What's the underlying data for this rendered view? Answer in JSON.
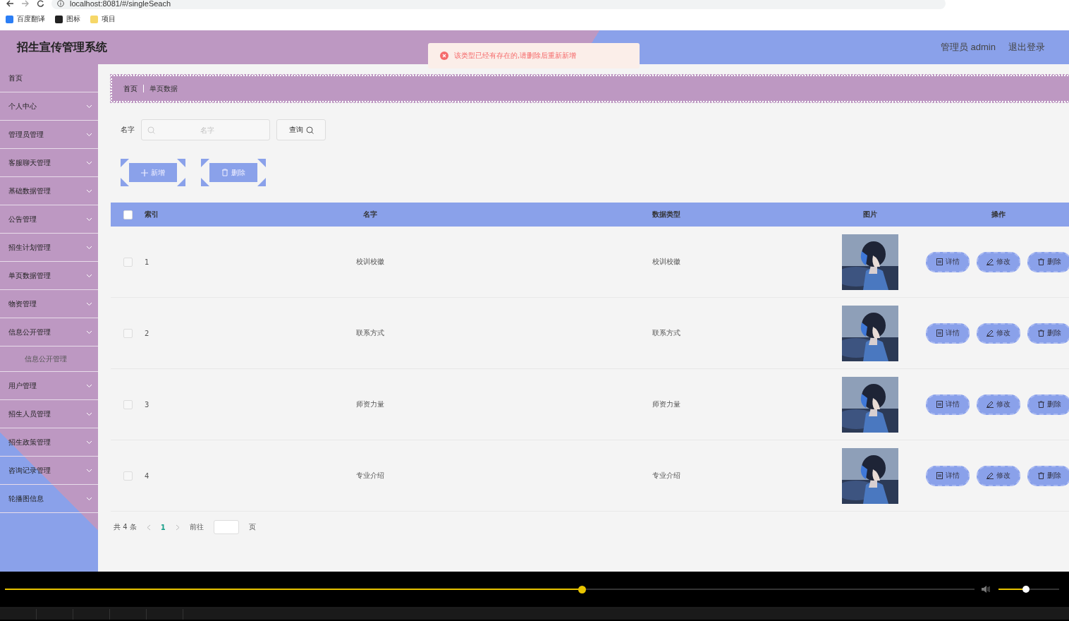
{
  "browser": {
    "url": "localhost:8081/#/singleSeach",
    "bookmarks": [
      {
        "label": "百度翻译",
        "kind": "translate"
      },
      {
        "label": "图标"
      },
      {
        "label": "项目",
        "kind": "folder"
      }
    ]
  },
  "header": {
    "title": "招生宣传管理系统",
    "user": "管理员 admin",
    "logout": "退出登录"
  },
  "toast": {
    "message": "该类型已经有存在的,请删除后重新新增"
  },
  "sidebar": {
    "items": [
      {
        "label": "首页",
        "kind": "link"
      },
      {
        "label": "个人中心",
        "kind": "menu"
      },
      {
        "label": "管理员管理",
        "kind": "menu"
      },
      {
        "label": "客服聊天管理",
        "kind": "menu"
      },
      {
        "label": "基础数据管理",
        "kind": "menu"
      },
      {
        "label": "公告管理",
        "kind": "menu"
      },
      {
        "label": "招生计划管理",
        "kind": "menu"
      },
      {
        "label": "单页数据管理",
        "kind": "menu"
      },
      {
        "label": "物资管理",
        "kind": "menu"
      },
      {
        "label": "信息公开管理",
        "kind": "menu",
        "children": [
          {
            "label": "信息公开管理"
          }
        ]
      },
      {
        "label": "用户管理",
        "kind": "menu"
      },
      {
        "label": "招生人员管理",
        "kind": "menu"
      },
      {
        "label": "招生政策管理",
        "kind": "menu"
      },
      {
        "label": "咨询记录管理",
        "kind": "menu"
      },
      {
        "label": "轮播图信息",
        "kind": "menu"
      }
    ]
  },
  "breadcrumb": [
    "首页",
    "单页数据"
  ],
  "search": {
    "label": "名字",
    "placeholder": "名字",
    "button": "查询"
  },
  "actions": [
    {
      "label": "新增",
      "kind": "add"
    },
    {
      "label": "删除",
      "kind": "delete"
    }
  ],
  "table": {
    "all_selected": false,
    "columns": [
      "索引",
      "名字",
      "数据类型",
      "图片",
      "操作"
    ],
    "rows": [
      {
        "index": "1",
        "name": "校训校徽",
        "type": "校训校徽",
        "selected": false,
        "actions": [
          {
            "label": "详情",
            "kind": "detail"
          },
          {
            "label": "修改",
            "kind": "edit"
          },
          {
            "label": "删除",
            "kind": "delete"
          }
        ]
      },
      {
        "index": "2",
        "name": "联系方式",
        "type": "联系方式",
        "selected": false,
        "actions": [
          {
            "label": "详情",
            "kind": "detail"
          },
          {
            "label": "修改",
            "kind": "edit"
          },
          {
            "label": "删除",
            "kind": "delete"
          }
        ]
      },
      {
        "index": "3",
        "name": "师资力量",
        "type": "师资力量",
        "selected": false,
        "actions": [
          {
            "label": "详情",
            "kind": "detail"
          },
          {
            "label": "修改",
            "kind": "edit"
          },
          {
            "label": "删除",
            "kind": "delete"
          }
        ]
      },
      {
        "index": "4",
        "name": "专业介绍",
        "type": "专业介绍",
        "selected": false,
        "actions": [
          {
            "label": "详情",
            "kind": "detail"
          },
          {
            "label": "修改",
            "kind": "edit"
          },
          {
            "label": "删除",
            "kind": "delete"
          }
        ]
      }
    ]
  },
  "pagination": {
    "total": "共 4 条",
    "pages": [
      {
        "label": "1",
        "selected": true
      }
    ],
    "goto": "前往",
    "suffix": "页"
  },
  "player": {
    "progress": {
      "level": 0.595
    },
    "volume": {
      "level": 0.45
    }
  }
}
